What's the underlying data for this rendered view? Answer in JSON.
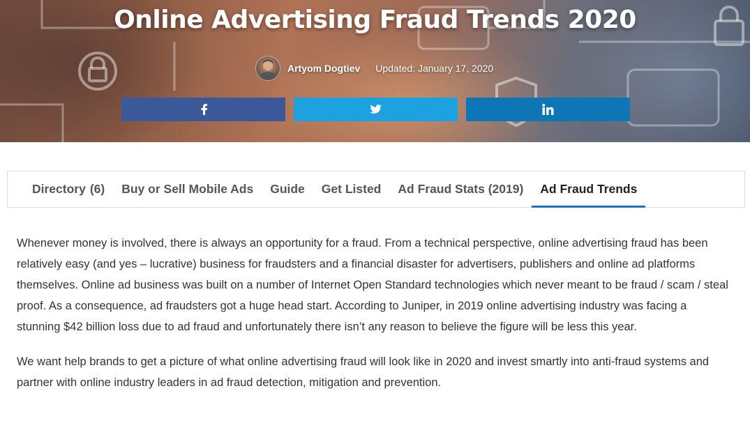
{
  "hero": {
    "title": "Online Advertising Fraud Trends 2020",
    "author": "Artyom Dogtiev",
    "updated": "Updated: January 17, 2020"
  },
  "share": {
    "buttons": [
      {
        "network": "facebook",
        "icon": "facebook-icon",
        "color": "#3b5998"
      },
      {
        "network": "twitter",
        "icon": "twitter-icon",
        "color": "#1da1e0"
      },
      {
        "network": "linkedin",
        "icon": "linkedin-icon",
        "color": "#0e76b6"
      }
    ]
  },
  "tabs": [
    {
      "label": "Directory",
      "count": "(6)"
    },
    {
      "label": "Buy or Sell Mobile Ads"
    },
    {
      "label": "Guide"
    },
    {
      "label": "Get Listed"
    },
    {
      "label": "Ad Fraud Stats (2019)"
    },
    {
      "label": "Ad Fraud Trends",
      "active": true
    }
  ],
  "accent_color": "#1e73be",
  "content": {
    "paragraphs": [
      "Whenever money is involved, there is always an opportunity for a fraud. From a technical perspective, online advertising fraud has been relatively easy (and yes – lucrative) business for fraudsters and a financial disaster for advertisers, publishers and online ad platforms themselves. Online ad business was built on a number of Internet Open Standard technologies which never meant to be fraud / scam / steal proof. As a consequence, ad fraudsters got a huge head start. According to Juniper, in 2019 online advertising industry was facing a stunning $42 billion loss due to ad fraud and unfortunately there isn’t any reason to believe the figure will be less this year.",
      "We want help brands to get a picture of what online advertising fraud will look like in 2020 and invest smartly into anti-fraud systems and partner with online industry leaders in ad fraud detection, mitigation and prevention."
    ]
  }
}
